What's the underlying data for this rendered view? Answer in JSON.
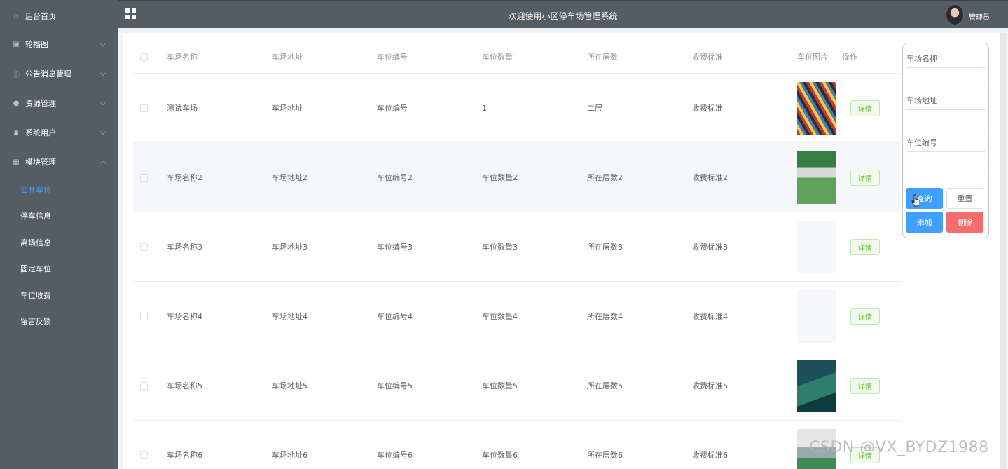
{
  "sidebar": {
    "items": [
      {
        "label": "后台首页",
        "icon": "home-icon"
      },
      {
        "label": "轮播图",
        "icon": "picture-icon"
      },
      {
        "label": "公告消息管理",
        "icon": "info-icon"
      },
      {
        "label": "资源管理",
        "icon": "bulb-icon"
      },
      {
        "label": "系统用户",
        "icon": "user-icon"
      },
      {
        "label": "模块管理",
        "icon": "grid-icon"
      }
    ],
    "subitems": [
      {
        "label": "公共车位",
        "active": true
      },
      {
        "label": "停车信息"
      },
      {
        "label": "离场信息"
      },
      {
        "label": "固定车位"
      },
      {
        "label": "车位收费"
      },
      {
        "label": "留言反馈"
      }
    ]
  },
  "header": {
    "title": "欢迎使用小区停车场管理系统",
    "user": "管理员"
  },
  "table": {
    "columns": [
      "车场名称",
      "车场地址",
      "车位编号",
      "车位数量",
      "所在层数",
      "收费标准",
      "车位图片",
      "操作"
    ],
    "detail_label": "详情",
    "rows": [
      [
        "测试车场",
        "车场地址",
        "车位编号",
        "1",
        "二层",
        "收费标准"
      ],
      [
        "车场名称2",
        "车场地址2",
        "车位编号2",
        "车位数量2",
        "所在层数2",
        "收费标准2"
      ],
      [
        "车场名称3",
        "车场地址3",
        "车位编号3",
        "车位数量3",
        "所在层数3",
        "收费标准3"
      ],
      [
        "车场名称4",
        "车场地址4",
        "车位编号4",
        "车位数量4",
        "所在层数4",
        "收费标准4"
      ],
      [
        "车场名称5",
        "车场地址5",
        "车位编号5",
        "车位数量5",
        "所在层数5",
        "收费标准5"
      ],
      [
        "车场名称6",
        "车场地址6",
        "车位编号6",
        "车位数量6",
        "所在层数6",
        "收费标准6"
      ]
    ]
  },
  "search": {
    "name_label": "车场名称",
    "address_label": "车场地址",
    "code_label": "车位编号",
    "query": "查询",
    "reset": "重置",
    "add": "添加",
    "delete": "删除"
  },
  "watermark": "CSDN @VX_BYDZ1988",
  "colors": {
    "primary": "#409eff",
    "danger": "#f56c6c",
    "success": "#67c23a",
    "sidebar": "#545c64"
  }
}
